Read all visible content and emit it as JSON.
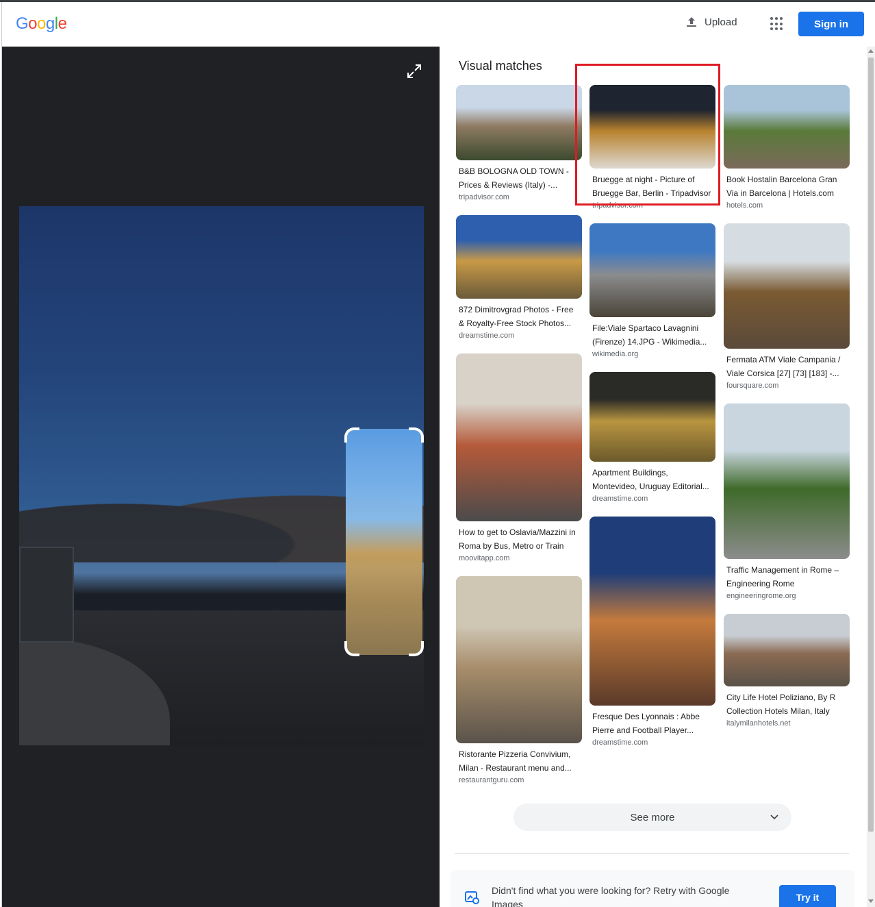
{
  "header": {
    "logo": [
      {
        "ch": "G",
        "color": "#4285F4"
      },
      {
        "ch": "o",
        "color": "#EA4335"
      },
      {
        "ch": "o",
        "color": "#FBBC05"
      },
      {
        "ch": "g",
        "color": "#4285F4"
      },
      {
        "ch": "l",
        "color": "#34A853"
      },
      {
        "ch": "e",
        "color": "#EA4335"
      }
    ],
    "upload_label": "Upload",
    "signin_label": "Sign in"
  },
  "results": {
    "title": "Visual matches",
    "columns": [
      [
        {
          "title": "B&B BOLOGNA OLD TOWN - Prices & Reviews (Italy) -...",
          "source": "tripadvisor.com",
          "colors": [
            "#c9d7e6",
            "#8f7a63",
            "#3b4a2e"
          ]
        },
        {
          "title": "872 Dimitrovgrad Photos - Free & Royalty-Free Stock Photos...",
          "source": "dreamstime.com",
          "colors": [
            "#2e5fae",
            "#c89a47",
            "#6b5a3a"
          ]
        },
        {
          "title": "How to get to Oslavia/Mazzini in Roma by Bus, Metro or Train",
          "source": "moovitapp.com",
          "colors": [
            "#d8d2c8",
            "#b55a3a",
            "#4b4b4b"
          ]
        },
        {
          "title": "Ristorante Pizzeria Convivium, Milan - Restaurant menu and...",
          "source": "restaurantguru.com",
          "colors": [
            "#cfc6b4",
            "#a78d6b",
            "#5a534a"
          ]
        }
      ],
      [
        {
          "title": "Bruegge at night - Picture of Bruegge Bar, Berlin - Tripadvisor",
          "source": "tripadvisor.com",
          "colors": [
            "#1e2430",
            "#b8822e",
            "#ddd8d0"
          ]
        },
        {
          "title": "File:Viale Spartaco Lavagnini (Firenze) 14.JPG - Wikimedia...",
          "source": "wikimedia.org",
          "colors": [
            "#3f78c2",
            "#8b8c8e",
            "#4a4438"
          ]
        },
        {
          "title": "Apartment Buildings, Montevideo, Uruguay Editorial...",
          "source": "dreamstime.com",
          "colors": [
            "#2a2a26",
            "#b8953f",
            "#6c5a2c"
          ]
        },
        {
          "title": "Fresque Des Lyonnais : Abbe Pierre and Football Player...",
          "source": "dreamstime.com",
          "colors": [
            "#1f3d78",
            "#c47a3c",
            "#5a3a2a"
          ]
        }
      ],
      [
        {
          "title": "Book Hostalin Barcelona Gran Via in Barcelona | Hotels.com",
          "source": "hotels.com",
          "colors": [
            "#a9c4d8",
            "#5a7a3a",
            "#7a6a5a"
          ]
        },
        {
          "title": "Fermata ATM Viale Campania / Viale Corsica [27] [73] [183] -...",
          "source": "foursquare.com",
          "colors": [
            "#d6dde2",
            "#7a5a32",
            "#5a4a3a"
          ]
        },
        {
          "title": "Traffic Management in Rome – Engineering Rome",
          "source": "engineeringrome.org",
          "colors": [
            "#c9d6df",
            "#3f6a2a",
            "#8c8c8c"
          ]
        },
        {
          "title": "City Life Hotel Poliziano, By R Collection Hotels Milan, Italy",
          "source": "italymilanhotels.net",
          "colors": [
            "#c7cdd2",
            "#8a6a52",
            "#5a5248"
          ]
        }
      ]
    ],
    "see_more_label": "See more",
    "retry_text": "Didn't find what you were looking for? Retry with Google Images",
    "try_it_label": "Try it"
  }
}
